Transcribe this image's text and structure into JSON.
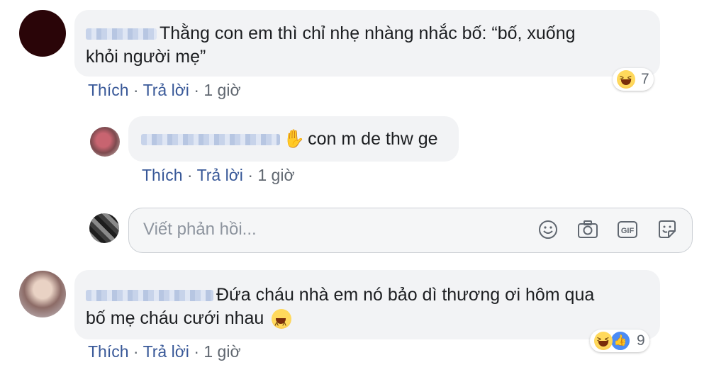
{
  "comments": [
    {
      "text_line1": "Thằng con em thì chỉ nhẹ nhàng nhắc bố: “bố, xuống",
      "text_line2": "khỏi người mẹ”",
      "actions": {
        "like": "Thích",
        "reply": "Trả lời",
        "time": "1 giờ"
      },
      "reactions": {
        "count": "7"
      }
    },
    {
      "text_line1": "con m de thw ge",
      "actions": {
        "like": "Thích",
        "reply": "Trả lời",
        "time": "1 giờ"
      }
    },
    {
      "text_line1": "Đứa cháu nhà em nó bảo dì thương ơi hôm qua",
      "text_line2": "bố mẹ cháu cưới nhau",
      "actions": {
        "like": "Thích",
        "reply": "Trả lời",
        "time": "1 giờ"
      },
      "reactions": {
        "count": "9"
      }
    }
  ],
  "reply_box": {
    "placeholder": "Viết phản hồi..."
  },
  "separator": "·",
  "icons": [
    "laugh-emoji-icon",
    "like-icon",
    "wave-hand-icon",
    "smiley-icon",
    "camera-icon",
    "gif-icon",
    "sticker-icon"
  ],
  "colors": {
    "link": "#385898",
    "bubble": "#f2f3f5",
    "meta": "#606770"
  }
}
